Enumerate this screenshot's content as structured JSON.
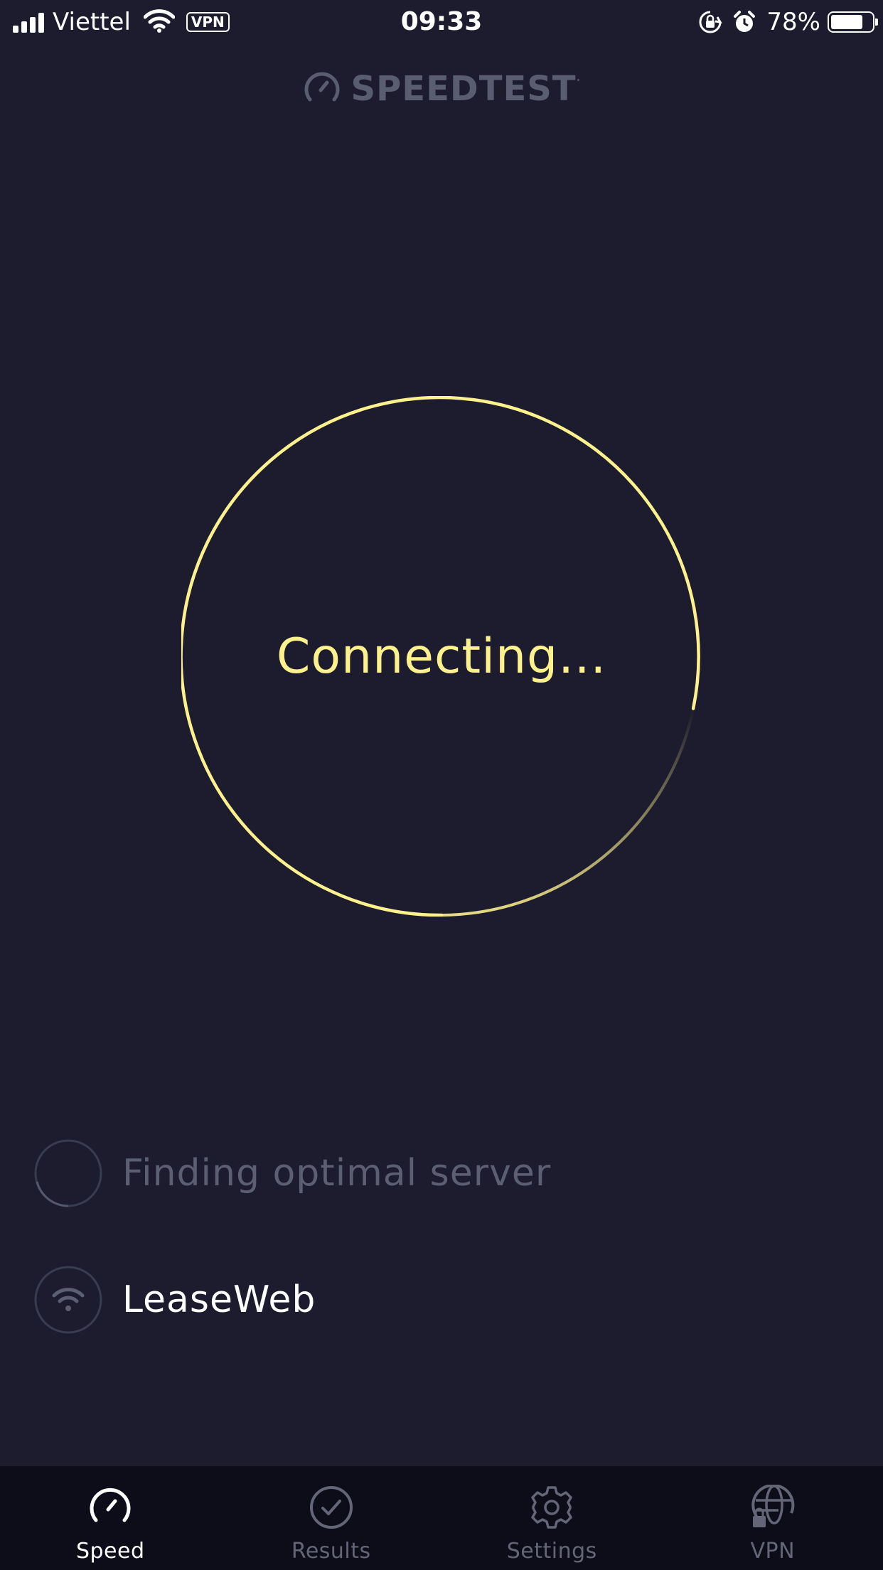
{
  "status_bar": {
    "carrier": "Viettel",
    "vpn_badge": "VPN",
    "time": "09:33",
    "battery_percent": "78%",
    "battery_level": 0.78,
    "icons": [
      "signal-icon",
      "wifi-icon",
      "orientation-lock-icon",
      "alarm-icon",
      "battery-icon"
    ]
  },
  "header": {
    "logo_text": "SPEEDTEST",
    "logo_icon": "speedometer-icon"
  },
  "gauge": {
    "status_text": "Connecting...",
    "ring_color": "#fdf18e"
  },
  "server": {
    "finding_text": "Finding optimal server",
    "isp_name": "LeaseWeb"
  },
  "tabs": [
    {
      "label": "Speed",
      "icon": "speedometer-icon",
      "active": true
    },
    {
      "label": "Results",
      "icon": "checkmark-circle-icon",
      "active": false
    },
    {
      "label": "Settings",
      "icon": "gear-icon",
      "active": false
    },
    {
      "label": "VPN",
      "icon": "globe-lock-icon",
      "active": false
    }
  ],
  "colors": {
    "background": "#1c1c2e",
    "tab_bar": "#0d0d19",
    "accent_yellow": "#fdf18e",
    "muted_text": "#5c5e72"
  }
}
